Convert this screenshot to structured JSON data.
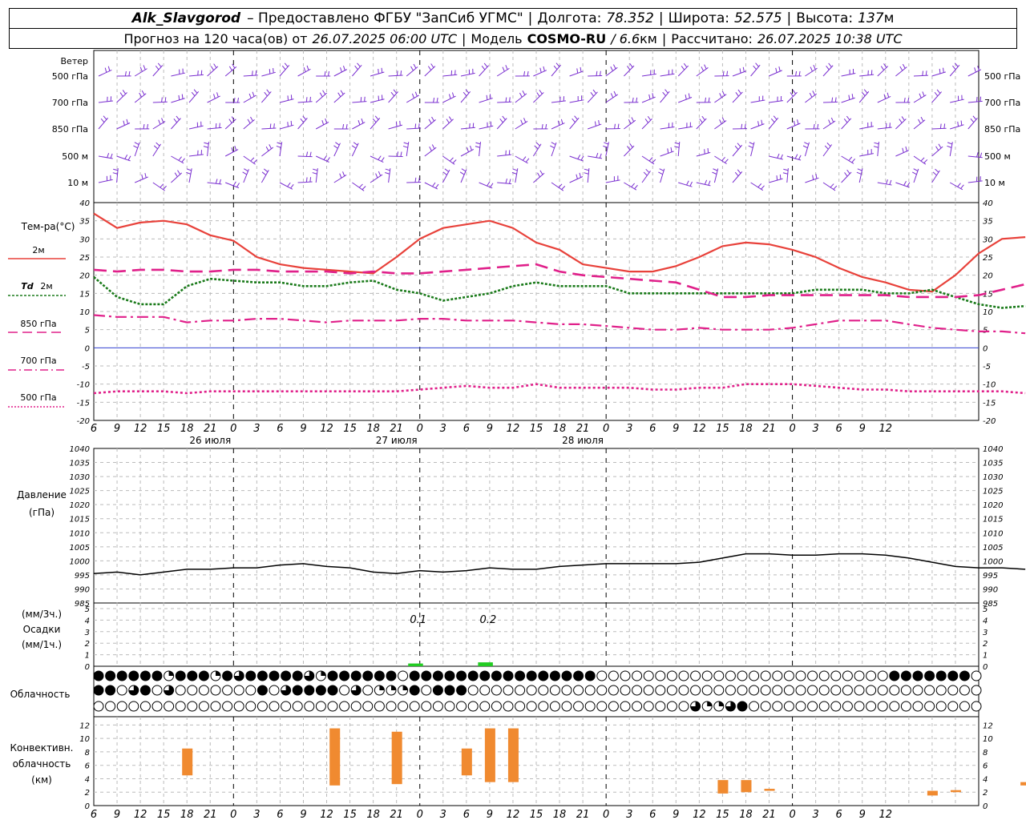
{
  "header": {
    "station": "Alk_Slavgorod",
    "provider": "– Предоставлено ФГБУ \"ЗапСиб УГМС\"",
    "lon_label": "Долгота:",
    "lon_value": "78.352",
    "lat_label": "Широта:",
    "lat_value": "52.575",
    "alt_label": "Высота:",
    "alt_value": "137",
    "alt_unit": "м",
    "forecast_prefix": "Прогноз на 120 часа(ов) от",
    "forecast_time": "26.07.2025 06:00 UTC",
    "model_label": "Модель",
    "model_name": "COSMO-RU",
    "model_res": "/ 6.6",
    "model_res_unit": "км",
    "computed_label": "Рассчитано:",
    "computed_time": "26.07.2025 10:38 UTC"
  },
  "labels": {
    "wind": "Ветер",
    "wind_levels": [
      "500 гПа",
      "700 гПа",
      "850 гПа",
      "500 м",
      "10 м"
    ],
    "temp": "Тем-ра(°C)",
    "t2m": "2м",
    "td": "Td",
    "td_suffix": "2м",
    "t850": "850 гПа",
    "t700": "700 гПа",
    "t500": "500 гПа",
    "pressure": "Давление",
    "pressure_unit": "(гПа)",
    "precip_unit3": "(мм/3ч.)",
    "precip": "Осадки",
    "precip_unit1": "(мм/1ч.)",
    "cloud": "Облачность",
    "conv1": "Конвективн.",
    "conv2": "облачность",
    "conv3": "(км)"
  },
  "colors": {
    "t2m": "#e8413a",
    "td": "#1a7a1a",
    "t850": "#e0208a",
    "t700": "#e0208a",
    "t500": "#e0208a",
    "wind": "#7a2fd0",
    "zero": "#3040d0",
    "precip": "#22cc22",
    "conv": "#f08a30",
    "pressure": "#000000"
  },
  "chart_data": [
    {
      "type": "line",
      "title": "Тем-ра(°C)",
      "x_hours_from_start": [
        0,
        3,
        6,
        9,
        12,
        15,
        18,
        21,
        24,
        27,
        30,
        33,
        36,
        39,
        42,
        45,
        48,
        51,
        54,
        57,
        60,
        63,
        66,
        69,
        72,
        75,
        78,
        81,
        84,
        87,
        90,
        93,
        96,
        99,
        102,
        105,
        108,
        111,
        114,
        117,
        120
      ],
      "ylim": [
        -20,
        40
      ],
      "series": [
        {
          "name": "2м",
          "values": [
            37,
            33,
            34.5,
            35,
            34,
            31,
            29.5,
            25,
            23,
            22,
            21.5,
            21,
            20.5,
            25,
            30,
            33,
            34,
            35,
            33,
            29,
            27,
            23,
            22,
            21,
            21,
            22.5,
            25,
            28,
            29,
            28.5,
            27,
            25,
            22,
            19.5,
            18,
            16,
            15.5,
            20,
            26,
            30,
            30.5
          ]
        },
        {
          "name": "Td 2м",
          "values": [
            19.5,
            14,
            12,
            12,
            17,
            19,
            18.5,
            18,
            18,
            17,
            17,
            18,
            18.5,
            16,
            15,
            13,
            14,
            15,
            17,
            18,
            17,
            17,
            17,
            15,
            15,
            15,
            15,
            15,
            15,
            15,
            15,
            16,
            16,
            16,
            15,
            15,
            16,
            14,
            12,
            11,
            11.5
          ]
        },
        {
          "name": "850 гПа",
          "values": [
            21.5,
            21,
            21.5,
            21.5,
            21,
            21,
            21.5,
            21.5,
            21,
            21,
            21,
            20.5,
            21,
            20.5,
            20.5,
            21,
            21.5,
            22,
            22.5,
            23,
            21,
            20,
            19.5,
            19,
            18.5,
            18,
            16,
            14,
            14,
            14.5,
            14.5,
            14.5,
            14.5,
            14.5,
            14.5,
            14,
            14,
            14,
            14.5,
            16,
            17.5
          ]
        },
        {
          "name": "700 гПа",
          "values": [
            9,
            8.5,
            8.5,
            8.5,
            7,
            7.5,
            7.5,
            8,
            8,
            7.5,
            7,
            7.5,
            7.5,
            7.5,
            8,
            8,
            7.5,
            7.5,
            7.5,
            7,
            6.5,
            6.5,
            6,
            5.5,
            5,
            5,
            5.5,
            5,
            5,
            5,
            5.5,
            6.5,
            7.5,
            7.5,
            7.5,
            6.5,
            5.5,
            5,
            4.5,
            4.5,
            4
          ]
        },
        {
          "name": "500 гПа",
          "values": [
            -12.5,
            -12,
            -12,
            -12,
            -12.5,
            -12,
            -12,
            -12,
            -12,
            -12,
            -12,
            -12,
            -12,
            -12,
            -11.5,
            -11,
            -10.5,
            -11,
            -11,
            -10,
            -11,
            -11,
            -11,
            -11,
            -11.5,
            -11.5,
            -11,
            -11,
            -10,
            -10,
            -10,
            -10.5,
            -11,
            -11.5,
            -11.5,
            -12,
            -12,
            -12,
            -12,
            -12,
            -12.5
          ]
        }
      ]
    },
    {
      "type": "line",
      "title": "Давление",
      "x_hours_from_start": [
        0,
        3,
        6,
        9,
        12,
        15,
        18,
        21,
        24,
        27,
        30,
        33,
        36,
        39,
        42,
        45,
        48,
        51,
        54,
        57,
        60,
        63,
        66,
        69,
        72,
        75,
        78,
        81,
        84,
        87,
        90,
        93,
        96,
        99,
        102,
        105,
        108,
        111,
        114,
        117,
        120
      ],
      "ylim": [
        985,
        1040
      ],
      "series": [
        {
          "name": "Давление",
          "values": [
            995.5,
            996,
            995,
            996,
            997,
            997,
            997.5,
            997.5,
            998.5,
            999,
            998,
            997.5,
            996,
            995.5,
            996.5,
            996,
            996.5,
            997.5,
            997,
            997,
            998,
            998.5,
            999,
            999,
            999,
            999,
            999.5,
            1001,
            1002.5,
            1002.5,
            1002,
            1002,
            1002.5,
            1002.5,
            1002,
            1001,
            999.5,
            998,
            997.5,
            997.5,
            997
          ]
        }
      ]
    },
    {
      "type": "bar",
      "title": "Осадки",
      "ylim": [
        0,
        5
      ],
      "bars": [
        {
          "hour": 42,
          "value": 0.1
        },
        {
          "hour": 51,
          "value": 0.2
        }
      ],
      "annotations": [
        "0.1",
        "0.2"
      ]
    },
    {
      "type": "bar",
      "title": "Конвективн. облачность",
      "ylim": [
        0,
        13
      ],
      "bars": [
        {
          "hour": 12,
          "base": 4.5,
          "top": 8.5
        },
        {
          "hour": 31,
          "base": 3,
          "top": 11.5
        },
        {
          "hour": 39,
          "base": 3.2,
          "top": 11
        },
        {
          "hour": 48,
          "base": 4.5,
          "top": 8.5
        },
        {
          "hour": 51,
          "base": 3.5,
          "top": 11.5
        },
        {
          "hour": 54,
          "base": 3.5,
          "top": 11.5
        },
        {
          "hour": 81,
          "base": 1.8,
          "top": 3.8
        },
        {
          "hour": 84,
          "base": 2,
          "top": 3.8
        },
        {
          "hour": 87,
          "base": 2.2,
          "top": 2.5
        },
        {
          "hour": 108,
          "base": 1.5,
          "top": 2.2
        },
        {
          "hour": 111,
          "base": 2,
          "top": 2.3
        },
        {
          "hour": 120,
          "base": 3,
          "top": 3.5
        }
      ]
    }
  ],
  "axes": {
    "x_ticks": [
      "6",
      "9",
      "12",
      "15",
      "18",
      "21",
      "0",
      "3",
      "6",
      "9",
      "12",
      "15",
      "18",
      "21",
      "0",
      "3",
      "6",
      "9",
      "12",
      "15",
      "18",
      "21",
      "0",
      "3",
      "6",
      "9",
      "12",
      "15",
      "18",
      "21",
      "0",
      "3",
      "6",
      "9",
      "12"
    ],
    "days": [
      "26 июля",
      "27 июля",
      "28 июля"
    ],
    "temp_ticks": [
      "40",
      "35",
      "30",
      "25",
      "20",
      "15",
      "10",
      "5",
      "0",
      "-5",
      "-10",
      "-15",
      "-20"
    ],
    "pressure_ticks": [
      "1040",
      "1035",
      "1030",
      "1025",
      "1020",
      "1015",
      "1010",
      "1005",
      "1000",
      "995",
      "990",
      "985"
    ],
    "precip_ticks": [
      "5",
      "4",
      "3",
      "2",
      "1",
      "0"
    ],
    "conv_ticks": [
      "12",
      "10",
      "8",
      "6",
      "4",
      "2",
      "0"
    ]
  },
  "clouds": {
    "upper": "3333331333132333332133333303333333333333333000000000000000000000000033333330",
    "middle": "3302302000000030233330201113033300000000000000000000000000000000000000000000",
    "lower": "0000000000000000000000000000000000000000000000000002112300000000000000000000"
  }
}
